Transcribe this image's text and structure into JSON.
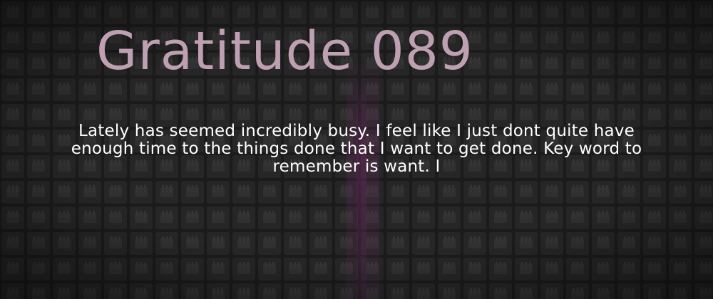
{
  "post": {
    "title": "Gratitude 089",
    "excerpt": "Lately has seemed incredibly busy.  I feel like I just dont quite have enough time to the things done that I want to get done. Key word to remember is want.  I"
  },
  "colors": {
    "background": "#1b1b1b",
    "pattern_tile": "#2c2c2c",
    "pattern_glyph": "#3a3a3a",
    "accent_glow": "#7a2a6e",
    "title": "#bfa0b2",
    "excerpt": "#ffffff"
  }
}
